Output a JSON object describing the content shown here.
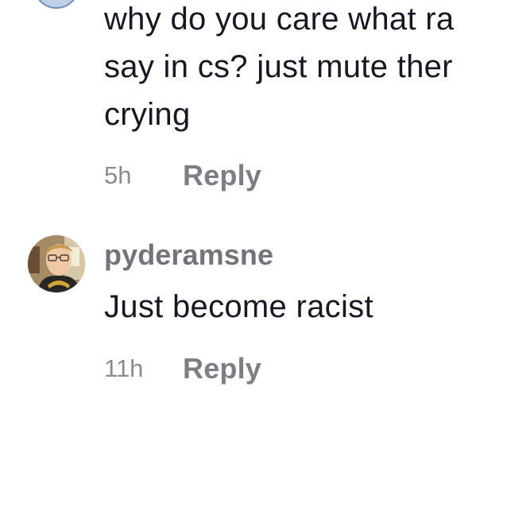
{
  "comments": [
    {
      "text_lines": [
        "why do you care what ra",
        "say in cs? just mute ther",
        "crying"
      ],
      "timestamp": "5h",
      "reply_label": "Reply"
    },
    {
      "username": "pyderamsne",
      "text": "Just become racist",
      "timestamp": "11h",
      "reply_label": "Reply"
    }
  ],
  "colors": {
    "body_text": "#161823",
    "meta_text": "#8a8b91",
    "username": "#73747b"
  }
}
